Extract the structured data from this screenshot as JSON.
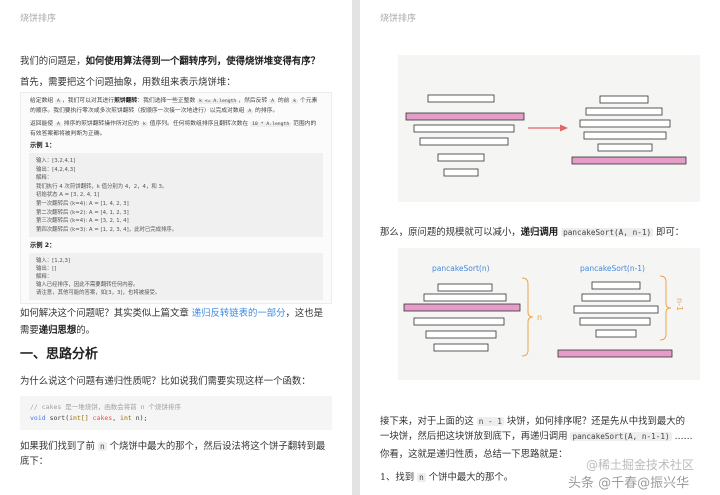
{
  "theme": {
    "link": "#3f8ae0",
    "highlight": "#e59cc8",
    "arrow": "#e06666",
    "bracket": "#eca54c",
    "figure_label": "#4a88d8"
  },
  "left": {
    "header": "烧饼排序",
    "p1": [
      {
        "t": "我们的问题是，"
      },
      {
        "t": "如何使用算法得到一个翻转序列，使得烧饼堆变得有序？",
        "b": true
      }
    ],
    "p2": [
      {
        "t": "首先，需要把这个问题抽象，用数组来表示烧饼堆："
      }
    ],
    "problem": {
      "desc": [
        [
          {
            "t": "给定数组 "
          },
          {
            "t": "A",
            "code": true
          },
          {
            "t": "，我们可以对其进行"
          },
          {
            "t": "煎饼翻转",
            "b": true
          },
          {
            "t": "：我们选择一些正整数 "
          },
          {
            "t": "k <= A.length",
            "code": true
          },
          {
            "t": "，然后反转 "
          },
          {
            "t": "A",
            "code": true
          },
          {
            "t": " 的前 "
          },
          {
            "t": "k",
            "code": true
          },
          {
            "t": " 个元素"
          }
        ],
        [
          {
            "t": "的顺序。我们要执行零次或多次煎饼翻转（按顺序一次接一次地进行）以完成对数组 "
          },
          {
            "t": "A",
            "code": true
          },
          {
            "t": " 的排序。"
          }
        ],
        [
          {
            "t": "返回能使 "
          },
          {
            "t": "A",
            "code": true
          },
          {
            "t": " 排序的煎饼翻转操作所对应的 "
          },
          {
            "t": "k",
            "code": true
          },
          {
            "t": " 值序列。任何将数组排序且翻转次数在 "
          },
          {
            "t": "10 * A.length",
            "code": true
          },
          {
            "t": " 范围内的"
          }
        ],
        [
          {
            "t": "有效答案都将被判断为正确。"
          }
        ]
      ],
      "example1": {
        "label": "示例 1：",
        "lines": [
          "输入：[3,2,4,1]",
          "输出：[4,2,4,3]",
          "解释：",
          "我们执行 4 次煎饼翻转，k 值分别为 4，2，4，和 3。",
          "初始状态 A = [3, 2, 4, 1]",
          "第一次翻转后 (k=4): A = [1, 4, 2, 3]",
          "第二次翻转后 (k=2): A = [4, 1, 2, 3]",
          "第三次翻转后 (k=4): A = [3, 2, 1, 4]",
          "第四次翻转后 (k=3): A = [1, 2, 3, 4]，此时已完成排序。"
        ]
      },
      "example2": {
        "label": "示例 2：",
        "lines": [
          "输入：[1,2,3]",
          "输出：[]",
          "解释：",
          "输入已经排序，因此不需要翻转任何内容。",
          "请注意，其他可能的答案，如[3，3]，也将被接受。"
        ]
      }
    },
    "p3": [
      [
        {
          "t": "如何解决这个问题呢？其实类似上篇文章 "
        },
        {
          "t": "递归反转链表的一部分",
          "link": true
        },
        {
          "t": "，这也是"
        }
      ],
      [
        {
          "t": "需要"
        },
        {
          "t": "递归思想",
          "b": true
        },
        {
          "t": "的。"
        }
      ]
    ],
    "heading": "一、思路分析",
    "p4": "为什么说这个问题有递归性质呢？比如说我们需要实现这样一个函数：",
    "code": [
      [
        {
          "t": "// cakes 是一堆烧饼，函数会将前 n 个烧饼排序",
          "color": "#a0a1a7"
        }
      ],
      [
        {
          "t": "void",
          "color": "#4078f2"
        },
        {
          "t": " sort("
        },
        {
          "t": "int[]",
          "color": "#986801"
        },
        {
          "t": " "
        },
        {
          "t": "cakes",
          "color": "#e45649"
        },
        {
          "t": ", "
        },
        {
          "t": "int",
          "color": "#986801"
        },
        {
          "t": " n);"
        }
      ]
    ],
    "p5": [
      [
        {
          "t": "如果我们找到了前 "
        },
        {
          "t": "n",
          "code": true
        },
        {
          "t": " 个烧饼中最大的那个，然后设法将这个饼子翻转到最"
        }
      ],
      [
        {
          "t": "底下："
        }
      ]
    ]
  },
  "right": {
    "header": "烧饼排序",
    "fig2": {
      "left_title": "pancakeSort(n)",
      "right_title": "pancakeSort(n-1)",
      "left_bracket": "n",
      "right_bracket": "n-1"
    },
    "p1": [
      {
        "t": "那么，原问题的规模就可以减小，"
      },
      {
        "t": "递归调用",
        "b": true
      },
      {
        "t": " "
      },
      {
        "t": "pancakeSort(A, n-1)",
        "code": true
      },
      {
        "t": " 即可："
      }
    ],
    "p2": [
      [
        {
          "t": "接下来，对于上面的这 "
        },
        {
          "t": "n - 1",
          "code": true
        },
        {
          "t": " 块饼，如何排序呢？还是先从中找到最大的"
        }
      ],
      [
        {
          "t": "一块饼，然后把这块饼放到底下，再递归调用 "
        },
        {
          "t": "pancakeSort(A, n-1-1)",
          "code": true
        },
        {
          "t": " ......"
        }
      ]
    ],
    "p3": "你看，这就是递归性质，总结一下思路就是：",
    "p4": [
      {
        "t": "1、找到 "
      },
      {
        "t": "n",
        "code": true
      },
      {
        "t": " 个饼中最大的那个。"
      }
    ]
  },
  "watermark": {
    "line1": "@稀土掘金技术社区",
    "line2": "头条 @千春@振兴华"
  }
}
